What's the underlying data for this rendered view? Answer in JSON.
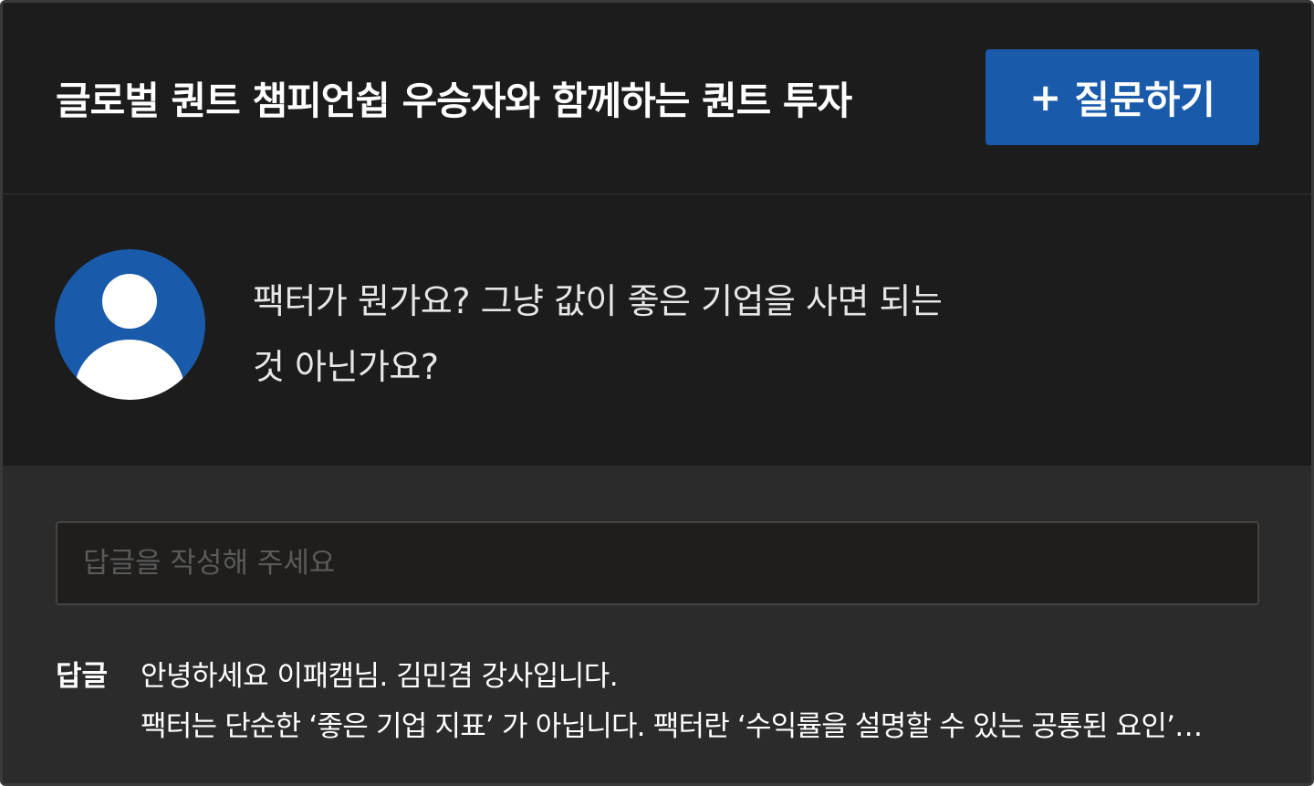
{
  "header": {
    "course_title": "글로벌 퀀트 챔피언쉽 우승자와 함께하는 퀀트 투자",
    "ask_button_icon": "+",
    "ask_button_label": "질문하기"
  },
  "question": {
    "avatar_icon": "user-avatar-icon",
    "text": "팩터가 뭔가요? 그냥 값이 좋은 기업을 사면 되는 것 아닌가요?"
  },
  "reply": {
    "input_value": "",
    "input_placeholder": "답글을 작성해 주세요"
  },
  "answer": {
    "label": "답글",
    "line1": "안녕하세요 이패캠님. 김민겸 강사입니다.",
    "line2": "팩터는 단순한 ‘좋은 기업 지표’ 가 아닙니다. 팩터란 ‘수익률을 설명할 수 있는 공통된 요인’…"
  },
  "colors": {
    "accent": "#1a5aab",
    "background_dark": "#1c1c1c",
    "background_answer": "#2b2b2b"
  }
}
